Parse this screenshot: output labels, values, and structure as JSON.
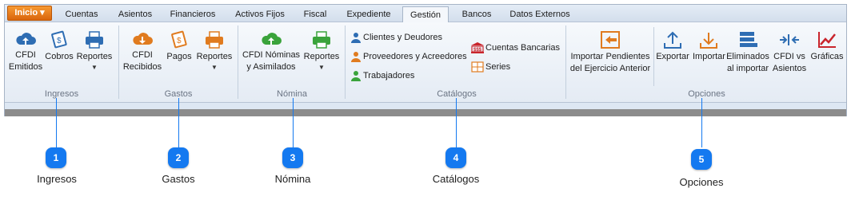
{
  "tabs": [
    "Inicio",
    "Cuentas",
    "Asientos",
    "Financieros",
    "Activos Fijos",
    "Fiscal",
    "Expediente",
    "Gestión",
    "Bancos",
    "Datos Externos"
  ],
  "groups": {
    "ingresos": {
      "label": "Ingresos",
      "buttons": [
        "CFDI Emitidos",
        "Cobros",
        "Reportes"
      ]
    },
    "gastos": {
      "label": "Gastos",
      "buttons": [
        "CFDI Recibidos",
        "Pagos",
        "Reportes"
      ]
    },
    "nomina": {
      "label": "Nómina",
      "buttons": [
        "CFDI Nóminas y Asimilados",
        "Reportes"
      ]
    },
    "catalogos": {
      "label": "Catálogos",
      "items": [
        "Clientes y Deudores",
        "Proveedores y Acreedores",
        "Trabajadores",
        "Cuentas Bancarias",
        "Series"
      ]
    },
    "opciones": {
      "label": "Opciones",
      "buttons": [
        "Importar Pendientes del Ejercicio Anterior",
        "Exportar",
        "Importar",
        "Eliminados al importar",
        "CFDI vs Asientos",
        "Gráficas"
      ]
    }
  },
  "callouts": [
    {
      "num": "1",
      "label": "Ingresos"
    },
    {
      "num": "2",
      "label": "Gastos"
    },
    {
      "num": "3",
      "label": "Nómina"
    },
    {
      "num": "4",
      "label": "Catálogos"
    },
    {
      "num": "5",
      "label": "Opciones"
    }
  ],
  "colors": {
    "accent": "#1479f0",
    "inicio": "#e87a1a",
    "icon_blue": "#2e6db3",
    "icon_orange": "#e07b1f",
    "icon_green": "#3aa33b",
    "icon_red": "#c9252c"
  }
}
